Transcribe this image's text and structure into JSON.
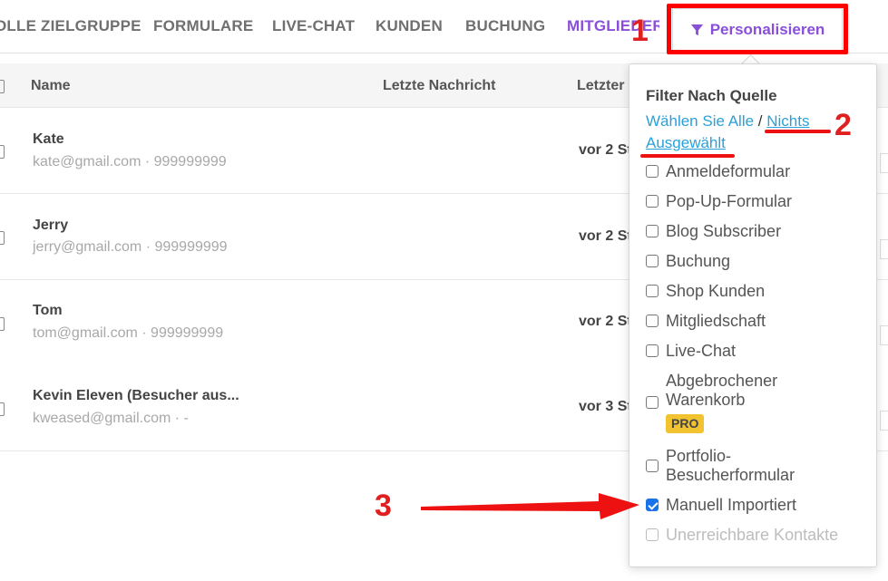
{
  "tabs": [
    {
      "label": "OLLE ZIELGRUPPE"
    },
    {
      "label": "FORMULARE"
    },
    {
      "label": "LIVE-CHAT"
    },
    {
      "label": "KUNDEN"
    },
    {
      "label": "BUCHUNG"
    },
    {
      "label": "MITGLIEDER"
    }
  ],
  "personalize_label": "Personalisieren",
  "table": {
    "columns": [
      "Name",
      "Letzte Nachricht",
      "Letzter"
    ],
    "rows": [
      {
        "name": "Kate",
        "sub": "kate@gmail.com · 999999999",
        "time": "vor 2 St"
      },
      {
        "name": "Jerry",
        "sub": "jerry@gmail.com · 999999999",
        "time": "vor 2 St"
      },
      {
        "name": "Tom",
        "sub": "tom@gmail.com · 999999999",
        "time": "vor 2 St"
      },
      {
        "name": "Kevin Eleven (Besucher aus...",
        "sub": "kweased@gmail.com · -",
        "time": "vor 3 St"
      }
    ]
  },
  "filter": {
    "title": "Filter Nach Quelle",
    "select_all": "Wählen Sie Alle",
    "separator": " / ",
    "select_none_1": "Nichts",
    "select_none_2": "Ausgewählt",
    "options": [
      {
        "label": "Anmeldeformular",
        "checked": false
      },
      {
        "label": "Pop-Up-Formular",
        "checked": false
      },
      {
        "label": "Blog Subscriber",
        "checked": false
      },
      {
        "label": "Buchung",
        "checked": false
      },
      {
        "label": "Shop Kunden",
        "checked": false
      },
      {
        "label": "Mitgliedschaft",
        "checked": false
      },
      {
        "label": "Live-Chat",
        "checked": false
      },
      {
        "label": "Abgebrochener Warenkorb",
        "checked": false,
        "badge": "PRO"
      },
      {
        "label": "Portfolio-Besucherformular",
        "checked": false
      },
      {
        "label": "Manuell Importiert",
        "checked": true
      },
      {
        "label": "Unerreichbare Kontakte",
        "checked": false,
        "disabled": true
      }
    ]
  },
  "annotations": {
    "n1": "1",
    "n2": "2",
    "n3": "3"
  },
  "colors": {
    "accent": "#8a4fd8",
    "link": "#2aa0d8",
    "annotation": "#ff0000",
    "pro_badge": "#f2c331"
  },
  "icons": {
    "personalize": "filter-icon"
  }
}
